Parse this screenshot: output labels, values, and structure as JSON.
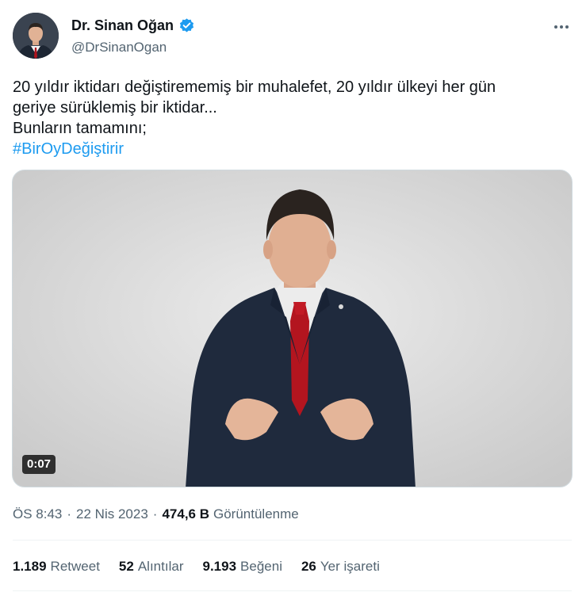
{
  "author": {
    "display_name": "Dr. Sinan Oğan",
    "handle": "@DrSinanOgan",
    "verified_icon": "verified-badge-icon",
    "verified_color": "#1d9bf0"
  },
  "tweet": {
    "lines": [
      "20 yıldır iktidarı değiştirememiş bir muhalefet, 20 yıldır ülkeyi her gün",
      "geriye sürüklemiş bir iktidar...",
      "Bunların tamamını;"
    ],
    "hashtag": "#BirOyDeğiştirir"
  },
  "media": {
    "type": "video",
    "duration": "0:07"
  },
  "meta": {
    "time": "ÖS 8:43",
    "date": "22 Nis 2023",
    "views_count": "474,6 B",
    "views_label": "Görüntülenme"
  },
  "stats": {
    "retweets": {
      "count": "1.189",
      "label": "Retweet"
    },
    "quotes": {
      "count": "52",
      "label": "Alıntılar"
    },
    "likes": {
      "count": "9.193",
      "label": "Beğeni"
    },
    "bookmarks": {
      "count": "26",
      "label": "Yer işareti"
    }
  },
  "colors": {
    "accent": "#1d9bf0",
    "text_primary": "#0f1419",
    "text_secondary": "#536471"
  }
}
